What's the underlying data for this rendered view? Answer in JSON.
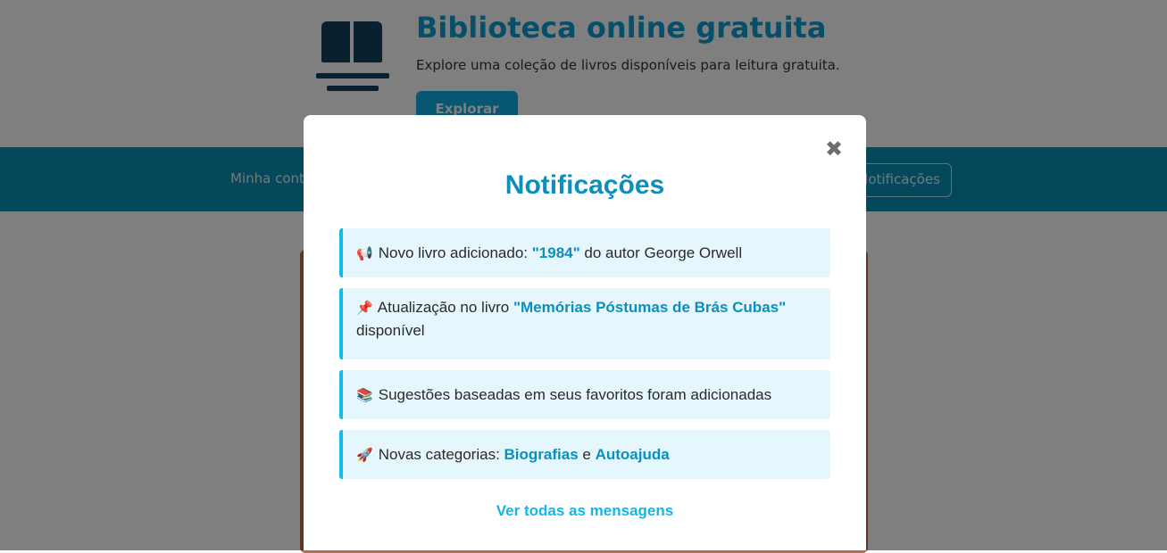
{
  "background": {
    "hero_title": "Biblioteca online gratuita",
    "hero_subtitle": "Explore uma coleção de livros disponíveis para leitura gratuita.",
    "hero_button": "Explorar",
    "nav_left": "Minha conta",
    "nav_right": "Notificações"
  },
  "modal": {
    "close_icon": "✖",
    "title": "Notificações",
    "notifications": [
      {
        "emoji": "📢",
        "prefix": "Novo livro adicionado: ",
        "highlight": "\"1984\"",
        "suffix": " do autor George Orwell"
      },
      {
        "emoji": "📌",
        "prefix": "Atualização no livro ",
        "highlight": "\"Memórias Póstumas de Brás Cubas\"",
        "suffix": " disponível"
      },
      {
        "emoji": "📚",
        "text": "Sugestões baseadas em seus favoritos foram adicionadas"
      },
      {
        "emoji": "🚀",
        "prefix": "Novas categorias: ",
        "highlight1": "Biografias",
        "middle": " e ",
        "highlight2": "Autoajuda"
      }
    ],
    "see_all": "Ver todas as mensagens"
  },
  "colors": {
    "accent": "#0b8fbd",
    "link": "#12b6e6",
    "notif_bg": "#e6f6fd",
    "notif_border": "#16bce9",
    "navbar": "#0b90b8"
  }
}
